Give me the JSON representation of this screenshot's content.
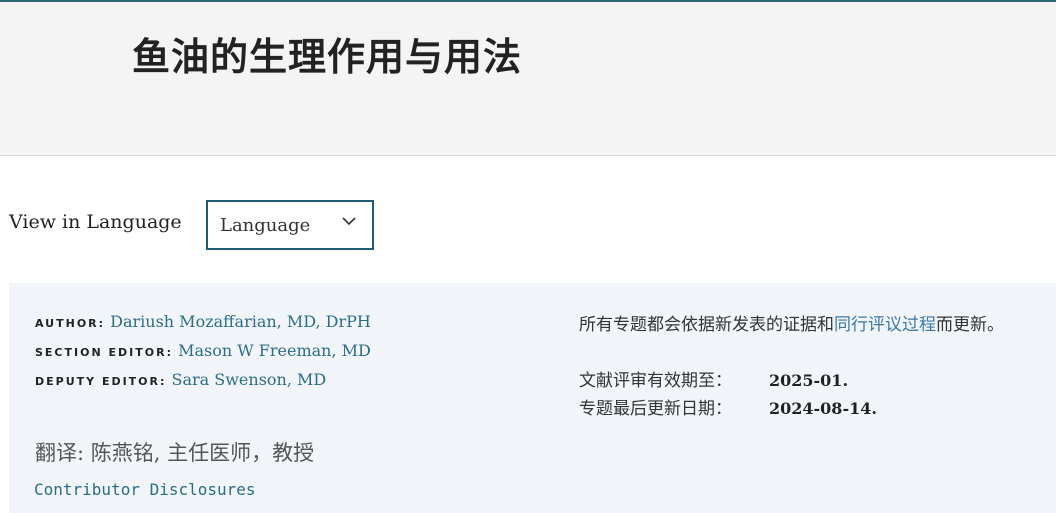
{
  "header": {
    "title": "鱼油的生理作用与用法"
  },
  "language": {
    "label": "View in Language",
    "selected": "Language"
  },
  "contributors": {
    "author_role": "AUTHOR",
    "author_name": "Dariush Mozaffarian, MD, DrPH",
    "section_editor_role": "SECTION EDITOR",
    "section_editor_name": "Mason W Freeman, MD",
    "deputy_editor_role": "DEPUTY EDITOR",
    "deputy_editor_name": "Sara Swenson, MD",
    "sep": ":"
  },
  "translator": "翻译: 陈燕铭, 主任医师，教授",
  "disclosures_link": "Contributor Disclosures",
  "policy": {
    "before": "所有专题都会依据新发表的证据和",
    "link": "同行评议过程",
    "after": "而更新。"
  },
  "review": {
    "current_label": "文献评审有效期至：",
    "current_value": "2025-01.",
    "updated_label": "专题最后更新日期：",
    "updated_value": "2024-08-14."
  },
  "colors": {
    "accent": "#1f5c74",
    "link": "#2b6d86",
    "header_bg": "#f4f4f4",
    "info_bg": "#f1f5f9"
  },
  "icons": {
    "dropdown": "chevron-down-icon"
  }
}
